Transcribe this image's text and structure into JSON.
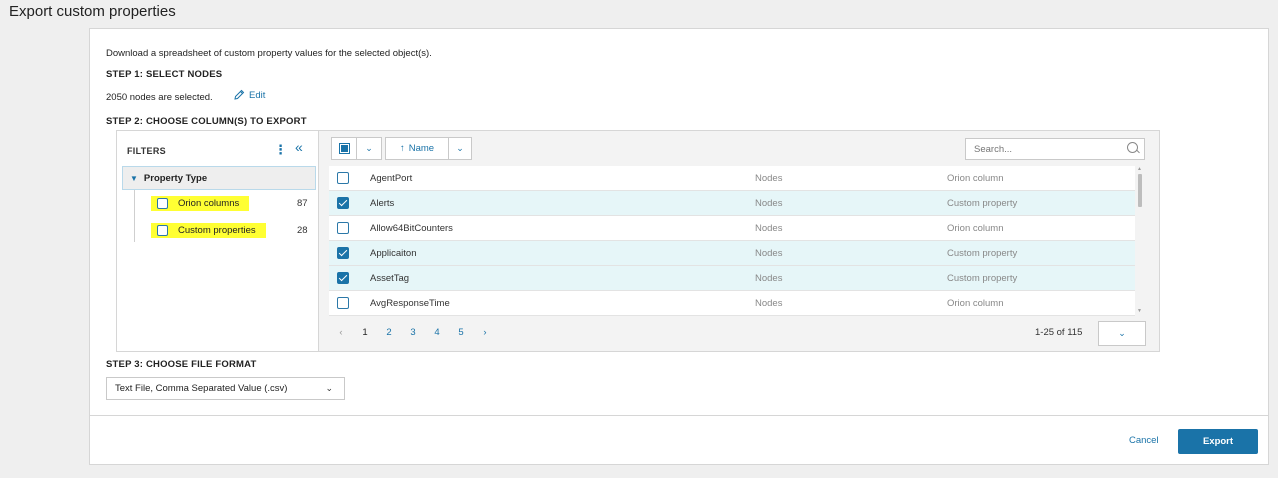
{
  "page": {
    "title": "Export custom properties"
  },
  "description": "Download a spreadsheet of custom property values for the selected object(s).",
  "step1": {
    "title": "STEP 1: SELECT NODES",
    "selected_text": "2050 nodes are selected.",
    "edit_label": "Edit"
  },
  "step2": {
    "title": "STEP 2: CHOOSE COLUMN(S) TO EXPORT",
    "filters": {
      "title": "FILTERS",
      "group_label": "Property Type",
      "items": [
        {
          "label": "Orion columns",
          "count": "87",
          "checked": false
        },
        {
          "label": "Custom properties",
          "count": "28",
          "checked": false
        }
      ]
    },
    "toolbar": {
      "sort_label": "Name",
      "search_placeholder": "Search..."
    },
    "rows": [
      {
        "name": "AgentPort",
        "type": "Nodes",
        "kind": "Orion column",
        "checked": false
      },
      {
        "name": "Alerts",
        "type": "Nodes",
        "kind": "Custom property",
        "checked": true
      },
      {
        "name": "Allow64BitCounters",
        "type": "Nodes",
        "kind": "Orion column",
        "checked": false
      },
      {
        "name": "Applicaiton",
        "type": "Nodes",
        "kind": "Custom property",
        "checked": true
      },
      {
        "name": "AssetTag",
        "type": "Nodes",
        "kind": "Custom property",
        "checked": true
      },
      {
        "name": "AvgResponseTime",
        "type": "Nodes",
        "kind": "Orion column",
        "checked": false
      }
    ],
    "pagination": {
      "pages": [
        "1",
        "2",
        "3",
        "4",
        "5"
      ],
      "current": "1",
      "range_text": "1-25 of 115"
    }
  },
  "step3": {
    "title": "STEP 3: CHOOSE FILE FORMAT",
    "format_value": "Text File, Comma Separated Value (.csv)"
  },
  "footer": {
    "cancel_label": "Cancel",
    "export_label": "Export"
  },
  "colors": {
    "accent": "#1a73a8",
    "highlight": "#ffff33",
    "selected_row": "#e6f6f8"
  }
}
